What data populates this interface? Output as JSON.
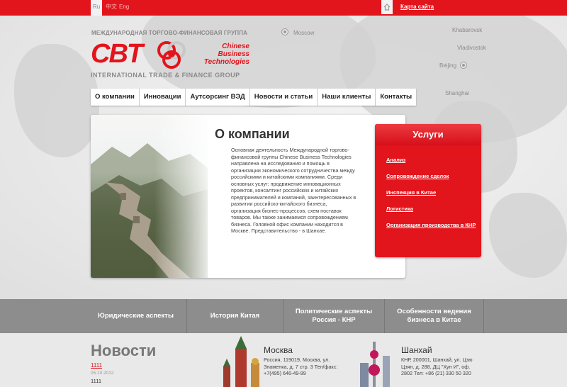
{
  "topbar": {
    "languages": [
      "Ru",
      "中文",
      "Eng"
    ],
    "active_language": "Ru",
    "sitemap_label": "Карта сайта"
  },
  "map": {
    "cities": [
      "Moscow",
      "Khabarovsk",
      "Vladivostok",
      "Beijing",
      "Shanghai"
    ]
  },
  "logo": {
    "top_text": "МЕЖДУНАРОДНАЯ ТОРГОВО-ФИНАНСОВАЯ ГРУППА",
    "letters": "CBT",
    "name_lines": [
      "Chinese",
      "Business",
      "Technologies"
    ],
    "bottom_text": "INTERNATIONAL TRADE & FINANCE GROUP"
  },
  "menu": [
    "О компании",
    "Инновации",
    "Аутсорсинг ВЭД",
    "Новости и статьи",
    "Наши клиенты",
    "Контакты"
  ],
  "about": {
    "title": "О компании",
    "text": "Основная деятельность Международной торгово-финансовой группы Chinese Business Technologies направлена на исследования и помощь в организации экономического сотрудничества между российскими и китайскими компаниями. Среди основных услуг: продвижение инновационных проектов, консалтинг российских и китайских предпринимателей и компаний, заинтересованных в развитии российско-китайского бизнеса, организация бизнес-процессов, схем поставок товаров. Мы также занимаемся сопровождением бизнеса. Головной офис компании находится в Москве. Представительство - в Шанхае."
  },
  "services": {
    "title": "Услуги",
    "items": [
      "Анализ",
      "Сопровождение сделок",
      "Инспекция в Китае",
      "Логистика",
      "Организация производства в КНР"
    ]
  },
  "band": [
    "Юридические аспекты",
    "История Китая",
    "Политические аспекты Россия - КНР",
    "Особенности ведения бизнеса в Китае"
  ],
  "news": {
    "title": "Новости",
    "link": "1111",
    "date": "05.10.2012",
    "text": "1111"
  },
  "offices": [
    {
      "city": "Москва",
      "address": "Россия, 119019, Москва, ул. Знаменка, д. 7 стр. 3 Тел/факс: +7(495) 646-49-99"
    },
    {
      "city": "Шанхай",
      "address": "КНР, 200001, Шанхай, ул. Цзю Цзян, д. 288, ДЦ \"Хун И\", оф. 2802 Тел: +86 (21) 330 50 320"
    }
  ],
  "colors": {
    "accent": "#e2141c",
    "band": "#8d8d8d",
    "background": "#e6e6e6"
  }
}
